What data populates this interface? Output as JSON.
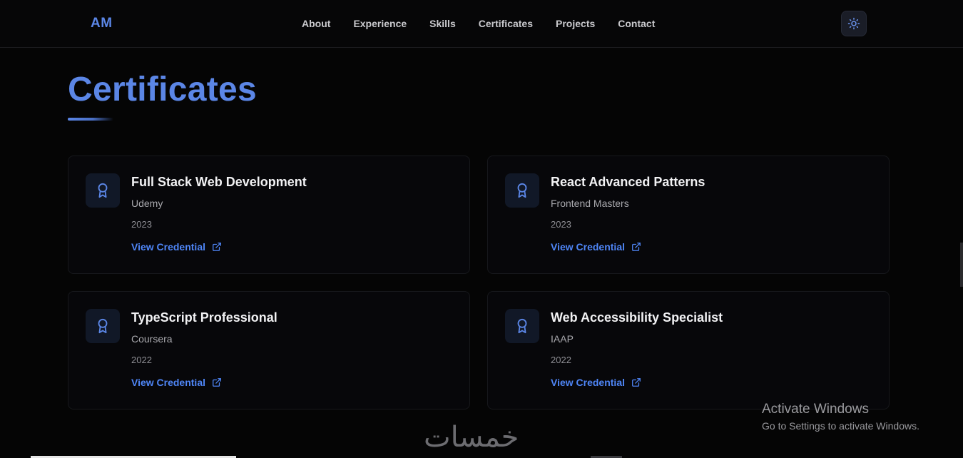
{
  "navbar": {
    "logo": "AM",
    "links": [
      "About",
      "Experience",
      "Skills",
      "Certificates",
      "Projects",
      "Contact"
    ],
    "theme_toggle_icon": "sun-icon"
  },
  "section": {
    "title": "Certificates"
  },
  "certificates": [
    {
      "title": "Full Stack Web Development",
      "issuer": "Udemy",
      "year": "2023",
      "link_label": "View Credential"
    },
    {
      "title": "React Advanced Patterns",
      "issuer": "Frontend Masters",
      "year": "2023",
      "link_label": "View Credential"
    },
    {
      "title": "TypeScript Professional",
      "issuer": "Coursera",
      "year": "2022",
      "link_label": "View Credential"
    },
    {
      "title": "Web Accessibility Specialist",
      "issuer": "IAAP",
      "year": "2022",
      "link_label": "View Credential"
    }
  ],
  "icons": {
    "certificate": "award-icon",
    "link": "external-link-icon"
  },
  "watermark": {
    "title": "Activate Windows",
    "subtitle": "Go to Settings to activate Windows."
  },
  "site_mark": "خمسات",
  "colors": {
    "accent": "#5b86e6",
    "link": "#4f86f7",
    "background": "#050505",
    "card_border": "#17181c"
  }
}
